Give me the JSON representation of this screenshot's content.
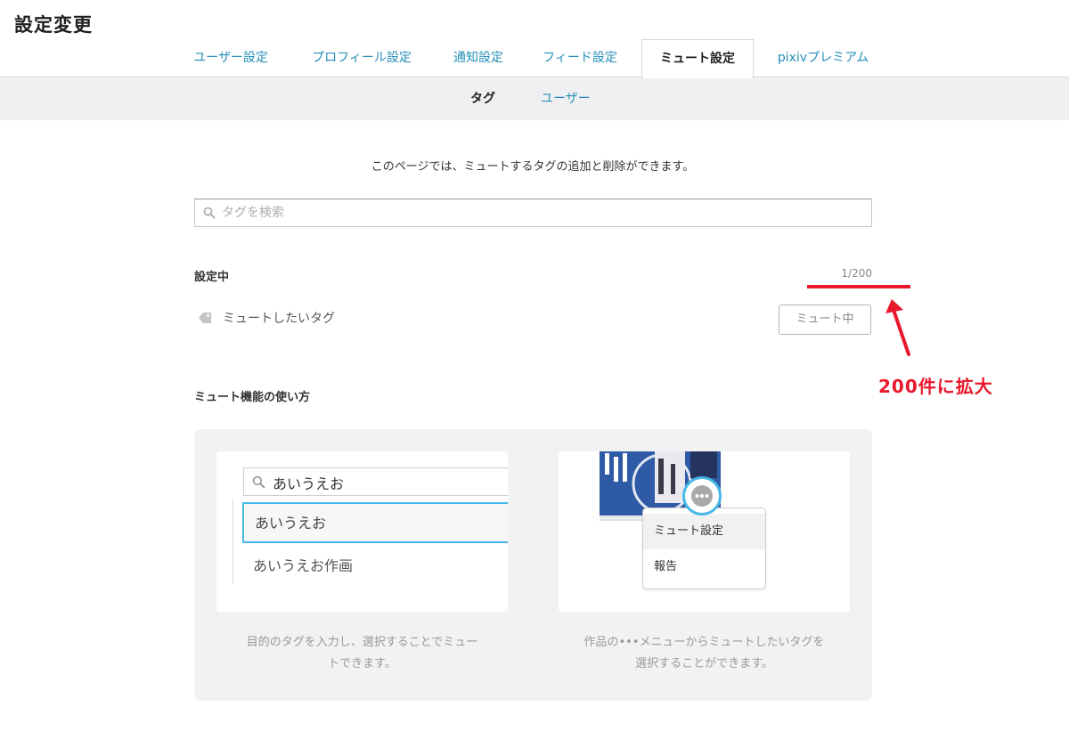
{
  "page": {
    "title": "設定変更"
  },
  "tabs": [
    {
      "label": "ユーザー設定"
    },
    {
      "label": "プロフィール設定"
    },
    {
      "label": "通知設定"
    },
    {
      "label": "フィード設定"
    },
    {
      "label": "ミュート設定",
      "active": true
    },
    {
      "label": "pixivプレミアム"
    }
  ],
  "subtabs": [
    {
      "label": "タグ",
      "active": true
    },
    {
      "label": "ユーザー"
    }
  ],
  "content": {
    "description": "このページでは、ミュートするタグの追加と削除ができます。",
    "search_placeholder": "タグを検索",
    "active_section_label": "設定中",
    "count": "1/200",
    "muted_tag": {
      "name": "ミュートしたいタグ",
      "icon": "tag-icon"
    },
    "mute_button_label": "ミュート中",
    "howto_label": "ミュート機能の使い方"
  },
  "annotation": {
    "text": "200件に拡大",
    "color": "#e8192c"
  },
  "howto": {
    "card1": {
      "search_text": "あいうえお",
      "suggestions": [
        "あいうえお",
        "あいうえお作画"
      ],
      "caption_line1": "目的のタグを入力し、選択することでミュー",
      "caption_line2": "トできます。"
    },
    "card2": {
      "menu_items": [
        "ミュート設定",
        "報告"
      ],
      "caption_line1": "作品の•••メニューからミュートしたいタグを",
      "caption_line2": "選択することができます。"
    }
  },
  "colors": {
    "link": "#258fb8",
    "accent": "#e8192c",
    "highlight": "#45b8e6"
  }
}
